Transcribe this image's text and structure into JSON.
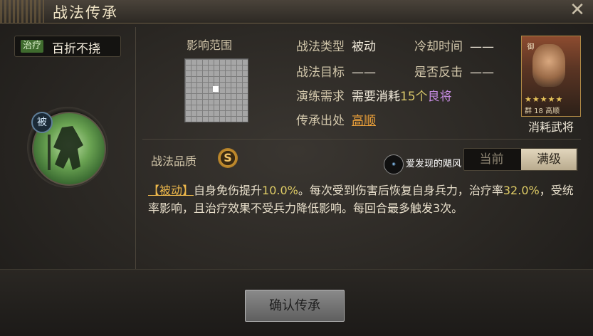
{
  "window": {
    "title": "战法传承"
  },
  "skill": {
    "tag": "治疗",
    "name": "百折不挠",
    "emblem_badge": "被"
  },
  "range": {
    "label": "影响范围"
  },
  "info": {
    "type_label": "战法类型",
    "type_value": "被动",
    "cooldown_label": "冷却时间",
    "cooldown_value": "——",
    "target_label": "战法目标",
    "target_value": "——",
    "counter_label": "是否反击",
    "counter_value": "——",
    "req_label": "演练需求",
    "req_prefix": "需要消耗",
    "req_count": "15个",
    "req_item": "良将",
    "source_label": "传承出处",
    "source_value": "高顺"
  },
  "portrait": {
    "side_text": "御",
    "stars": "★★★★★",
    "meta": "群 18 高顺",
    "label": "消耗武将"
  },
  "quality": {
    "label": "战法品质",
    "grade": "S"
  },
  "watermark": {
    "text": "爱发现的飓风"
  },
  "level_toggle": {
    "current": "当前",
    "max": "满级"
  },
  "description": {
    "tag": "【被动】",
    "p1": "自身免伤提升",
    "v1": "10.0%",
    "p2": "。每次受到伤害后恢复自身兵力，治疗率",
    "v2": "32.0%",
    "p3": "，受统率影响，且治疗效果不受兵力降低影响。每回合最多触发3次。"
  },
  "actions": {
    "confirm": "确认传承"
  },
  "colors": {
    "accent_gold": "#efb94c",
    "heal_green": "#3f6b2e",
    "purple": "#c58be0"
  }
}
